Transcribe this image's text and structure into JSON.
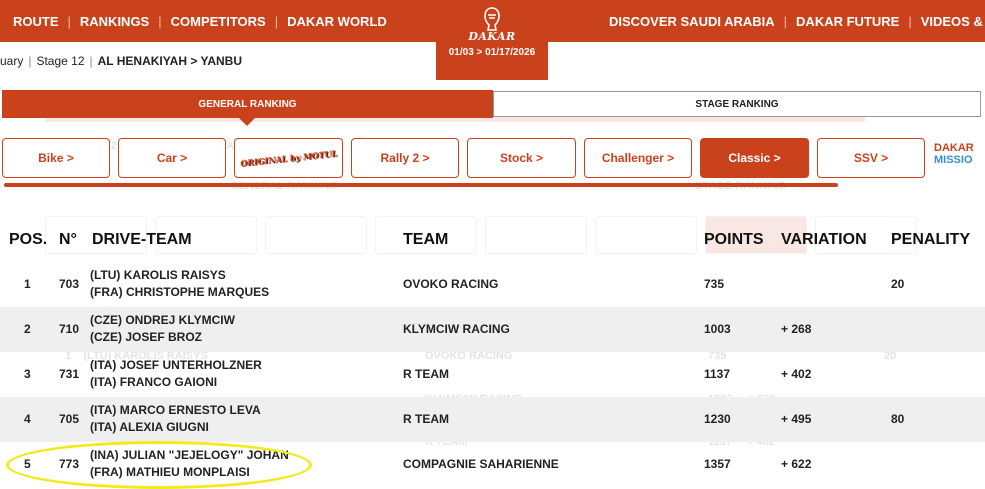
{
  "nav": {
    "left": [
      "ROUTE",
      "RANKINGS",
      "COMPETITORS",
      "DAKAR WORLD"
    ],
    "right": [
      "DISCOVER SAUDI ARABIA",
      "DAKAR FUTURE",
      "VIDEOS & PH"
    ],
    "logo_text": "DAKAR",
    "dates": "01/03 > 01/17/2026"
  },
  "breadcrumb": {
    "date": "uary",
    "stage": "Stage 12",
    "route": "AL HENAKIYAH > YANBU"
  },
  "ranking_tabs": {
    "general": "GENERAL RANKING",
    "stage": "STAGE RANKING"
  },
  "categories": [
    {
      "label": "Bike >",
      "active": false
    },
    {
      "label": "Car >",
      "active": false
    },
    {
      "label": "ORIGINAL by MOTUL",
      "active": false,
      "logo": true
    },
    {
      "label": "Rally 2 >",
      "active": false
    },
    {
      "label": "Stock >",
      "active": false
    },
    {
      "label": "Challenger >",
      "active": false
    },
    {
      "label": "Classic >",
      "active": true
    },
    {
      "label": "SSV >",
      "active": false
    }
  ],
  "category_logo_partial": {
    "line1": "DAKAR",
    "line2": "MISSIO"
  },
  "table": {
    "headers": {
      "pos": "POS.",
      "num": "N°",
      "drive_team": "DRIVE-TEAM",
      "team": "TEAM",
      "points": "POINTS",
      "variation": "VARIATION",
      "penalty": "PENALITY"
    },
    "rows": [
      {
        "pos": "1",
        "num": "703",
        "driver1": "(LTU)  KAROLIS RAISYS",
        "driver2": "(FRA)  CHRISTOPHE MARQUES",
        "team": "OVOKO RACING",
        "points": "735",
        "variation": "",
        "penalty": "20"
      },
      {
        "pos": "2",
        "num": "710",
        "driver1": "(CZE)  ONDREJ KLYMCIW",
        "driver2": "(CZE)  JOSEF BROZ",
        "team": "KLYMCIW RACING",
        "points": "1003",
        "variation": "+ 268",
        "penalty": ""
      },
      {
        "pos": "3",
        "num": "731",
        "driver1": "(ITA)  JOSEF UNTERHOLZNER",
        "driver2": "(ITA)  FRANCO GAIONI",
        "team": "R TEAM",
        "points": "1137",
        "variation": "+ 402",
        "penalty": ""
      },
      {
        "pos": "4",
        "num": "705",
        "driver1": "(ITA)  MARCO ERNESTO LEVA",
        "driver2": "(ITA)  ALEXIA GIUGNI",
        "team": "R TEAM",
        "points": "1230",
        "variation": "+ 495",
        "penalty": "80"
      },
      {
        "pos": "5",
        "num": "773",
        "driver1": "(INA)  JULIAN \"JEJELOGY\" JOHAN",
        "driver2": "(FRA)  MATHIEU MONPLAISI",
        "team": "COMPAGNIE SAHARIENNE",
        "points": "1357",
        "variation": "+ 622",
        "penalty": ""
      }
    ]
  },
  "colors": {
    "accent": "#c9421c",
    "highlight": "#f2ea1c",
    "alt_row": "#efefef"
  }
}
